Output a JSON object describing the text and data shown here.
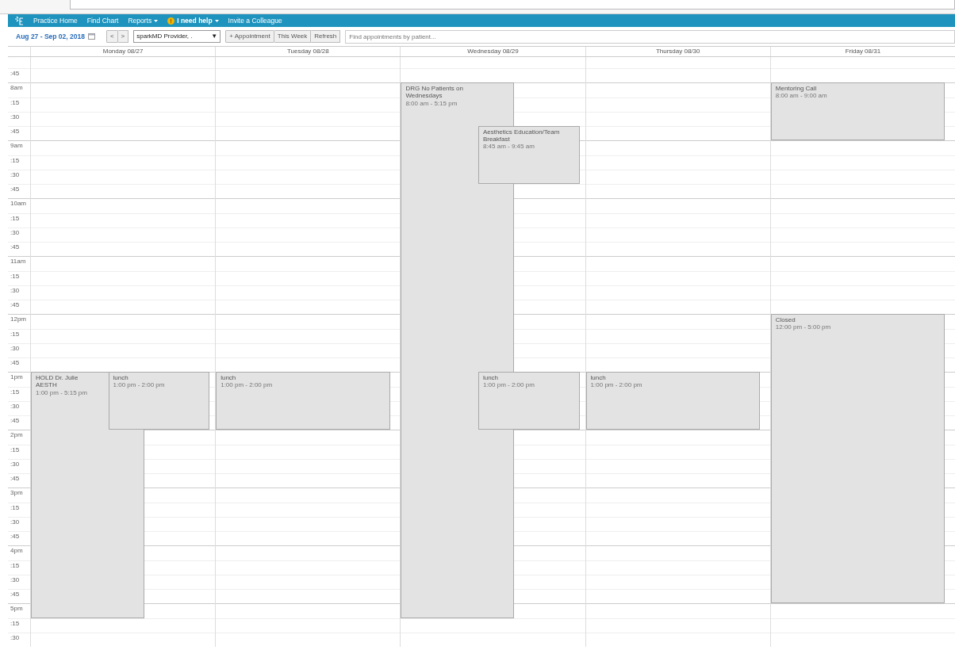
{
  "nav": {
    "items": [
      {
        "label": "Practice Home",
        "kind": "link"
      },
      {
        "label": "Find Chart",
        "kind": "link"
      },
      {
        "label": "Reports",
        "kind": "dropdown"
      },
      {
        "label": "I need help",
        "kind": "help"
      },
      {
        "label": "Invite a Colleague",
        "kind": "link"
      }
    ]
  },
  "toolbar": {
    "date_range": "Aug 27 - Sep 02, 2018",
    "prev": "<",
    "next": ">",
    "provider": "sparkMD Provider, .",
    "provider_caret": "▼",
    "buttons": [
      "+ Appointment",
      "This Week",
      "Refresh"
    ],
    "search": {
      "placeholder": "Find appointments by patient..."
    }
  },
  "calendar": {
    "days": [
      {
        "label": "Monday 08/27",
        "events": [
          {
            "title": "HOLD Dr. Julie AESTH",
            "time": "1:00 pm - 5:15 pm"
          },
          {
            "title": "lunch",
            "time": "1:00 pm - 2:00 pm"
          }
        ]
      },
      {
        "label": "Tuesday 08/28",
        "events": [
          {
            "title": "lunch",
            "time": "1:00 pm - 2:00 pm"
          }
        ]
      },
      {
        "label": "Wednesday 08/29",
        "events": [
          {
            "title": "DRG No Patients on Wednesdays",
            "time": "8:00 am - 5:15 pm"
          },
          {
            "title": "Aesthetics Education/Team Breakfast",
            "time": "8:45 am - 9:45 am"
          },
          {
            "title": "lunch",
            "time": "1:00 pm - 2:00 pm"
          }
        ]
      },
      {
        "label": "Thursday 08/30",
        "events": [
          {
            "title": "lunch",
            "time": "1:00 pm - 2:00 pm"
          }
        ]
      },
      {
        "label": "Friday 08/31",
        "events": [
          {
            "title": "Mentoring Call",
            "time": "8:00 am - 9:00 am"
          },
          {
            "title": "Closed",
            "time": "12:00 pm - 5:00 pm"
          }
        ]
      }
    ],
    "time_labels": [
      {
        "label": ":45",
        "kind": "quarter"
      },
      {
        "label": "8am",
        "kind": "hour"
      },
      {
        "label": ":15",
        "kind": "quarter"
      },
      {
        "label": ":30",
        "kind": "quarter"
      },
      {
        "label": ":45",
        "kind": "quarter"
      },
      {
        "label": "9am",
        "kind": "hour"
      },
      {
        "label": ":15",
        "kind": "quarter"
      },
      {
        "label": ":30",
        "kind": "quarter"
      },
      {
        "label": ":45",
        "kind": "quarter"
      },
      {
        "label": "10am",
        "kind": "hour"
      },
      {
        "label": ":15",
        "kind": "quarter"
      },
      {
        "label": ":30",
        "kind": "quarter"
      },
      {
        "label": ":45",
        "kind": "quarter"
      },
      {
        "label": "11am",
        "kind": "hour"
      },
      {
        "label": ":15",
        "kind": "quarter"
      },
      {
        "label": ":30",
        "kind": "quarter"
      },
      {
        "label": ":45",
        "kind": "quarter"
      },
      {
        "label": "12pm",
        "kind": "hour"
      },
      {
        "label": ":15",
        "kind": "quarter"
      },
      {
        "label": ":30",
        "kind": "quarter"
      },
      {
        "label": ":45",
        "kind": "quarter"
      },
      {
        "label": "1pm",
        "kind": "hour"
      },
      {
        "label": ":15",
        "kind": "quarter"
      },
      {
        "label": ":30",
        "kind": "quarter"
      },
      {
        "label": ":45",
        "kind": "quarter"
      },
      {
        "label": "2pm",
        "kind": "hour"
      },
      {
        "label": ":15",
        "kind": "quarter"
      },
      {
        "label": ":30",
        "kind": "quarter"
      },
      {
        "label": ":45",
        "kind": "quarter"
      },
      {
        "label": "3pm",
        "kind": "hour"
      },
      {
        "label": ":15",
        "kind": "quarter"
      },
      {
        "label": ":30",
        "kind": "quarter"
      },
      {
        "label": ":45",
        "kind": "quarter"
      },
      {
        "label": "4pm",
        "kind": "hour"
      },
      {
        "label": ":15",
        "kind": "quarter"
      },
      {
        "label": ":30",
        "kind": "quarter"
      },
      {
        "label": ":45",
        "kind": "quarter"
      },
      {
        "label": "5pm",
        "kind": "hour"
      },
      {
        "label": ":15",
        "kind": "quarter"
      },
      {
        "label": ":30",
        "kind": "quarter"
      }
    ]
  }
}
